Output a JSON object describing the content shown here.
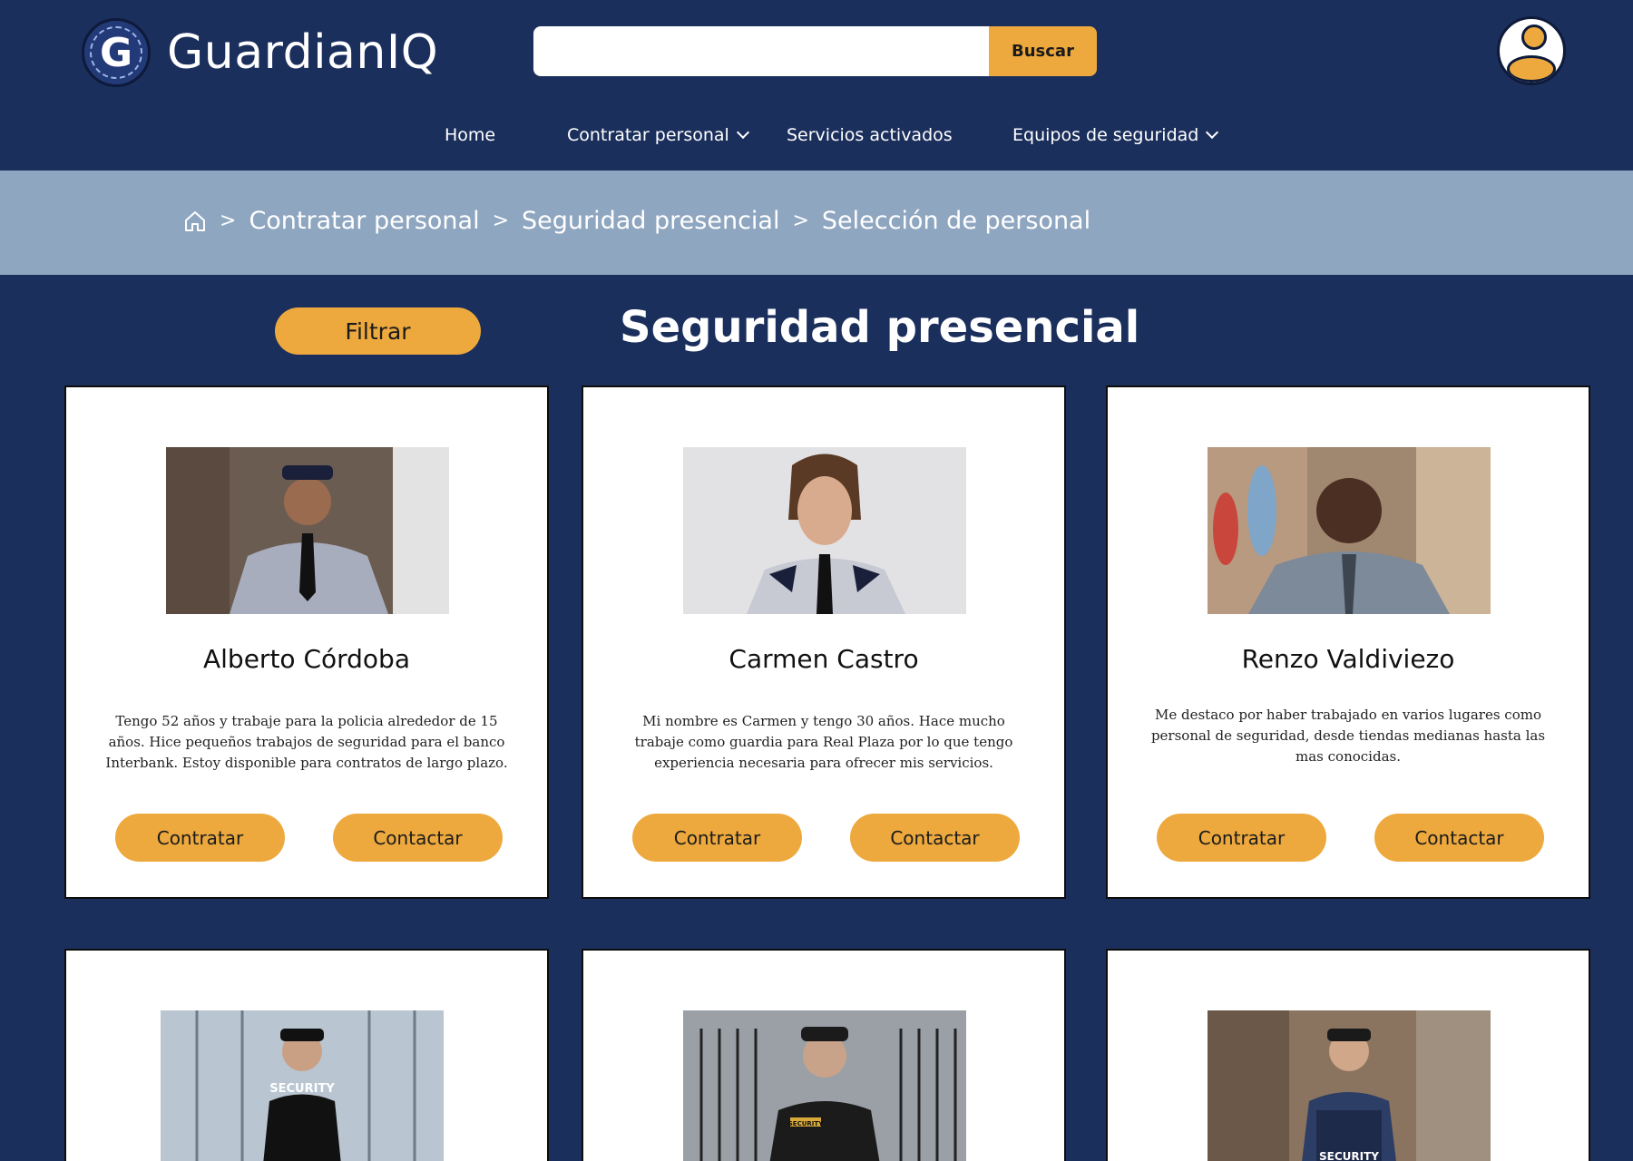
{
  "header": {
    "brand": "GuardianIQ",
    "logo_letter": "G",
    "search": {
      "placeholder": "",
      "button_label": "Buscar"
    }
  },
  "nav": {
    "items": [
      {
        "label": "Home",
        "has_dropdown": false
      },
      {
        "label": "Contratar personal",
        "has_dropdown": true
      },
      {
        "label": "Servicios activados",
        "has_dropdown": false
      },
      {
        "label": "Equipos de seguridad",
        "has_dropdown": true
      }
    ]
  },
  "breadcrumb": {
    "items": [
      "Contratar personal",
      "Seguridad presencial",
      "Selección de personal"
    ],
    "separator": ">"
  },
  "main": {
    "filter_label": "Filtrar",
    "title": "Seguridad presencial"
  },
  "cards": [
    {
      "name": "Alberto Córdoba",
      "description": "Tengo 52 años y trabaje para la policia alrededor de 15 años. Hice pequeños trabajos de seguridad para el banco Interbank. Estoy disponible para contratos de largo plazo.",
      "hire_label": "Contratar",
      "contact_label": "Contactar",
      "photo": "guard-photo-gray-uniform"
    },
    {
      "name": "Carmen Castro",
      "description": "Mi nombre es Carmen y tengo 30 años. Hace mucho trabaje como guardia para Real Plaza por lo que tengo experiencia necesaria para ofrecer mis servicios.",
      "hire_label": "Contratar",
      "contact_label": "Contactar",
      "photo": "guard-photo-woman-uniform"
    },
    {
      "name": "Renzo Valdiviezo",
      "description": "Me destaco por haber trabajado en varios lugares como personal de seguridad, desde tiendas medianas hasta las mas conocidas.",
      "hire_label": "Contratar",
      "contact_label": "Contactar",
      "photo": "guard-photo-police-uniform"
    },
    {
      "photo": "guard-photo-security-tshirt",
      "photo_text": "SECURITY"
    },
    {
      "photo": "guard-photo-black-uniform-gate",
      "photo_text": "SECURITY"
    },
    {
      "photo": "guard-photo-security-vest",
      "photo_text": "SECURITY"
    }
  ],
  "colors": {
    "background": "#1b2f5c",
    "accent": "#eda93d",
    "breadcrumb_bar": "#8fa6c0",
    "card": "#ffffff"
  }
}
